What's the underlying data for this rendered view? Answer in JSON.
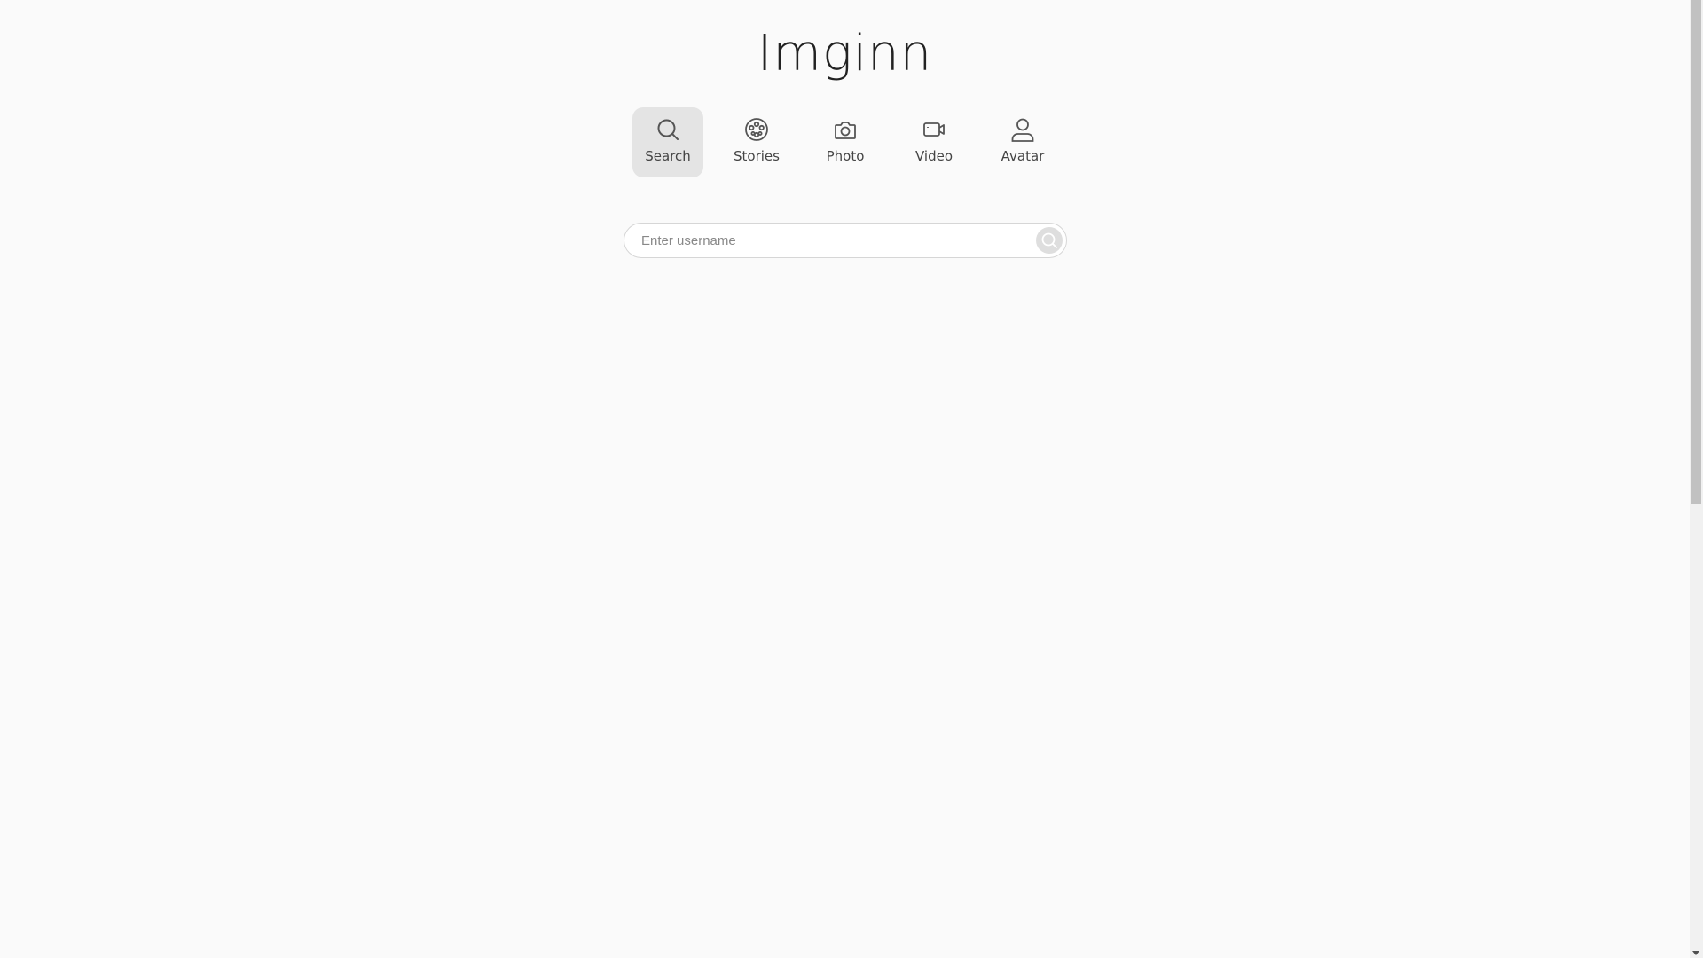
{
  "logo": "Imginn",
  "nav": [
    {
      "label": "Search",
      "icon": "search-icon",
      "active": true
    },
    {
      "label": "Stories",
      "icon": "film-reel-icon",
      "active": false
    },
    {
      "label": "Photo",
      "icon": "camera-icon",
      "active": false
    },
    {
      "label": "Video",
      "icon": "video-camera-icon",
      "active": false
    },
    {
      "label": "Avatar",
      "icon": "user-icon",
      "active": false
    }
  ],
  "search": {
    "placeholder": "Enter username",
    "value": ""
  },
  "colors": {
    "background": "#fafafa",
    "active_tab": "#e4e4e4",
    "icon": "#555555"
  }
}
